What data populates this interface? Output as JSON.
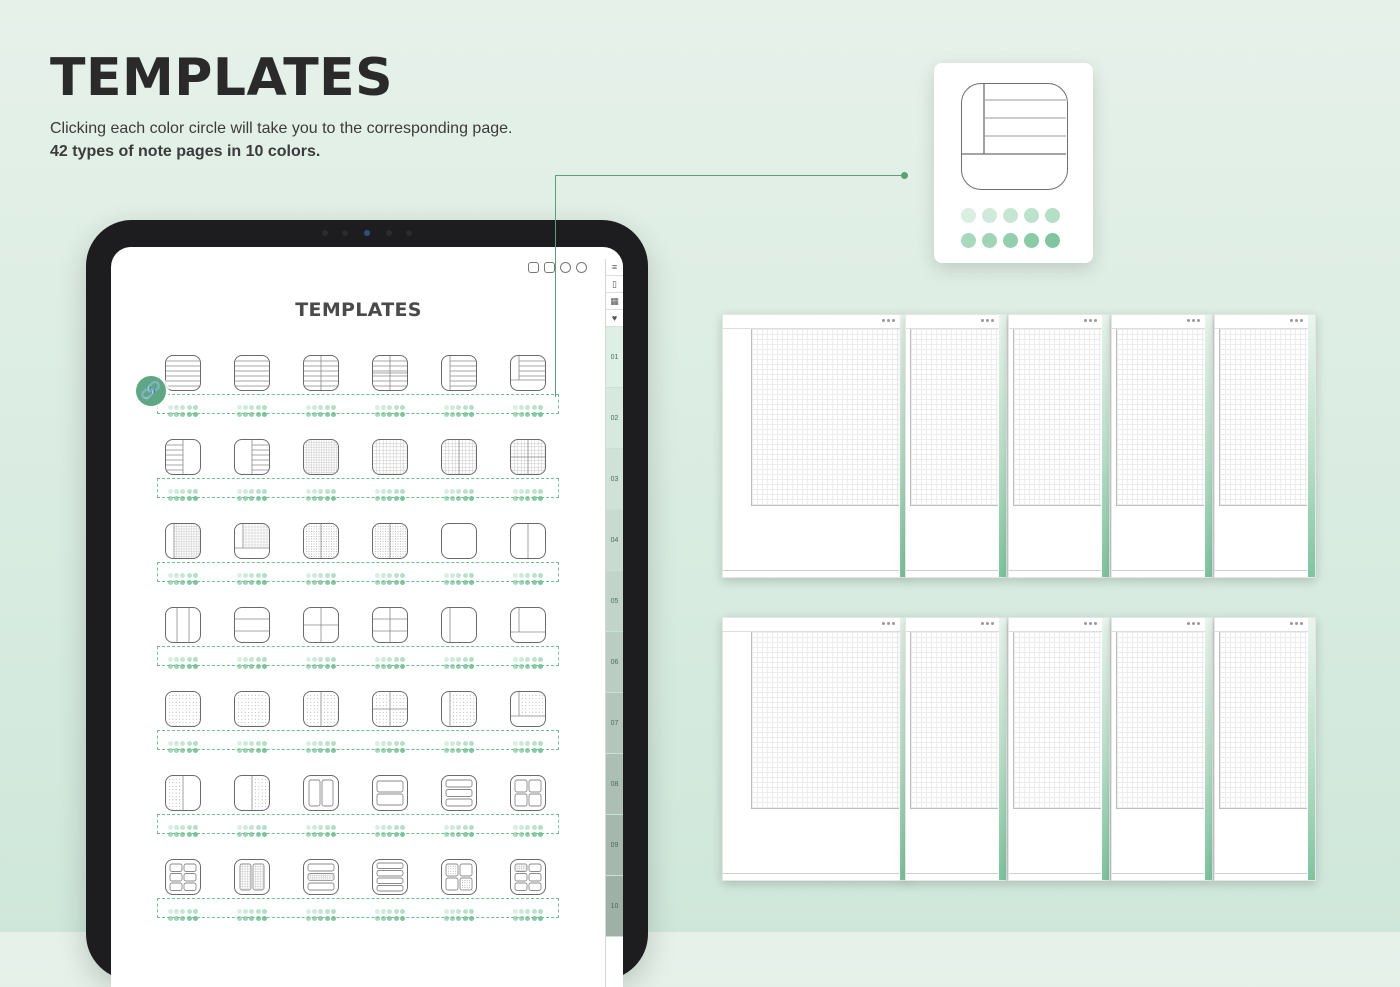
{
  "header": {
    "title": "TEMPLATES",
    "subtitle": "Clicking each color circle will take you to the corresponding page.",
    "subtitle_bold": "42 types of note pages in 10 colors."
  },
  "screen": {
    "title": "TEMPLATES",
    "toolbar_icons": [
      "calendar-check-icon",
      "inbox-icon",
      "globe-icon",
      "settings-icon"
    ],
    "side_icons": [
      "menu-icon",
      "notebook-icon",
      "calendar-icon",
      "heart-icon"
    ],
    "tabs": [
      "01",
      "02",
      "03",
      "04",
      "05",
      "06",
      "07",
      "08",
      "09",
      "10"
    ]
  },
  "colors": {
    "light_dots": [
      "#d9efe2",
      "#cfeadb",
      "#c6e6d3",
      "#bde2cc",
      "#b4dec5"
    ],
    "dark_dots": [
      "#a9d9bd",
      "#9fd4b5",
      "#94cfad",
      "#8acaa6",
      "#7fc59e"
    ],
    "accent": "#5da882"
  },
  "templates": {
    "rows": [
      [
        "lined",
        "lined",
        "lined-split",
        "lined-cross",
        "lined-left",
        "lined-corner"
      ],
      [
        "lined-half",
        "lined-half-right",
        "dotgrid",
        "grid",
        "grid-split",
        "grid-cross"
      ],
      [
        "grid-left",
        "grid-corner",
        "dot-split",
        "dot-split-2",
        "blank",
        "blank-split"
      ],
      [
        "blank-thirds",
        "blank-rows",
        "blank-cross",
        "blank-cross-2",
        "blank-left",
        "blank-corner"
      ],
      [
        "dots",
        "dots-2",
        "dots-split",
        "dots-cross",
        "dots-left",
        "dots-corner"
      ],
      [
        "dots-half",
        "dots-half-2",
        "two-cols",
        "two-rows",
        "three-rows",
        "four-grid"
      ],
      [
        "six-grid",
        "two-cols-b",
        "three-rows-b",
        "four-rows",
        "four-grid-b",
        "six-grid-b"
      ]
    ]
  },
  "zoom": {
    "icon": "lined-corner-template-icon"
  }
}
